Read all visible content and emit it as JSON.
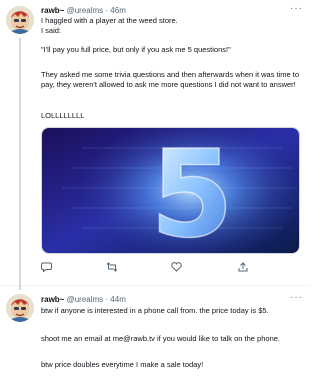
{
  "tweets": [
    {
      "display_name": "rawb~",
      "handle": "@urealms",
      "separator": "·",
      "time": "46m",
      "more_glyph": "···",
      "lines": [
        "I haggled with a player at the weed store.",
        "I said:",
        "\"I'll pay you full price, but only if you ask me 5 questions!\"",
        "They asked me some trivia questions and then afterwards when it was time to pay, they weren't allowed to ask me more questions I did not want to answer!",
        "LOLLLLLLLL"
      ],
      "media": {
        "description_icon": "glowing-number-5",
        "glyph": "5"
      },
      "actions": {
        "reply_icon": "reply-icon",
        "retweet_icon": "retweet-icon",
        "like_icon": "heart-icon",
        "share_icon": "share-icon"
      }
    },
    {
      "display_name": "rawb~",
      "handle": "@urealms",
      "separator": "·",
      "time": "44m",
      "more_glyph": "···",
      "lines": [
        "btw if anyone is interested in a phone call from. the price today is $5.",
        "shoot me an email at me@rawb.tv if you would like to talk on the phone.",
        "btw price doubles everytime I make a sale today!"
      ]
    }
  ],
  "colors": {
    "text": "#0f1419",
    "muted": "#536471",
    "border": "#eff3f4",
    "thread_line": "#cfd9de",
    "media_glow": "#7fb8ff"
  }
}
